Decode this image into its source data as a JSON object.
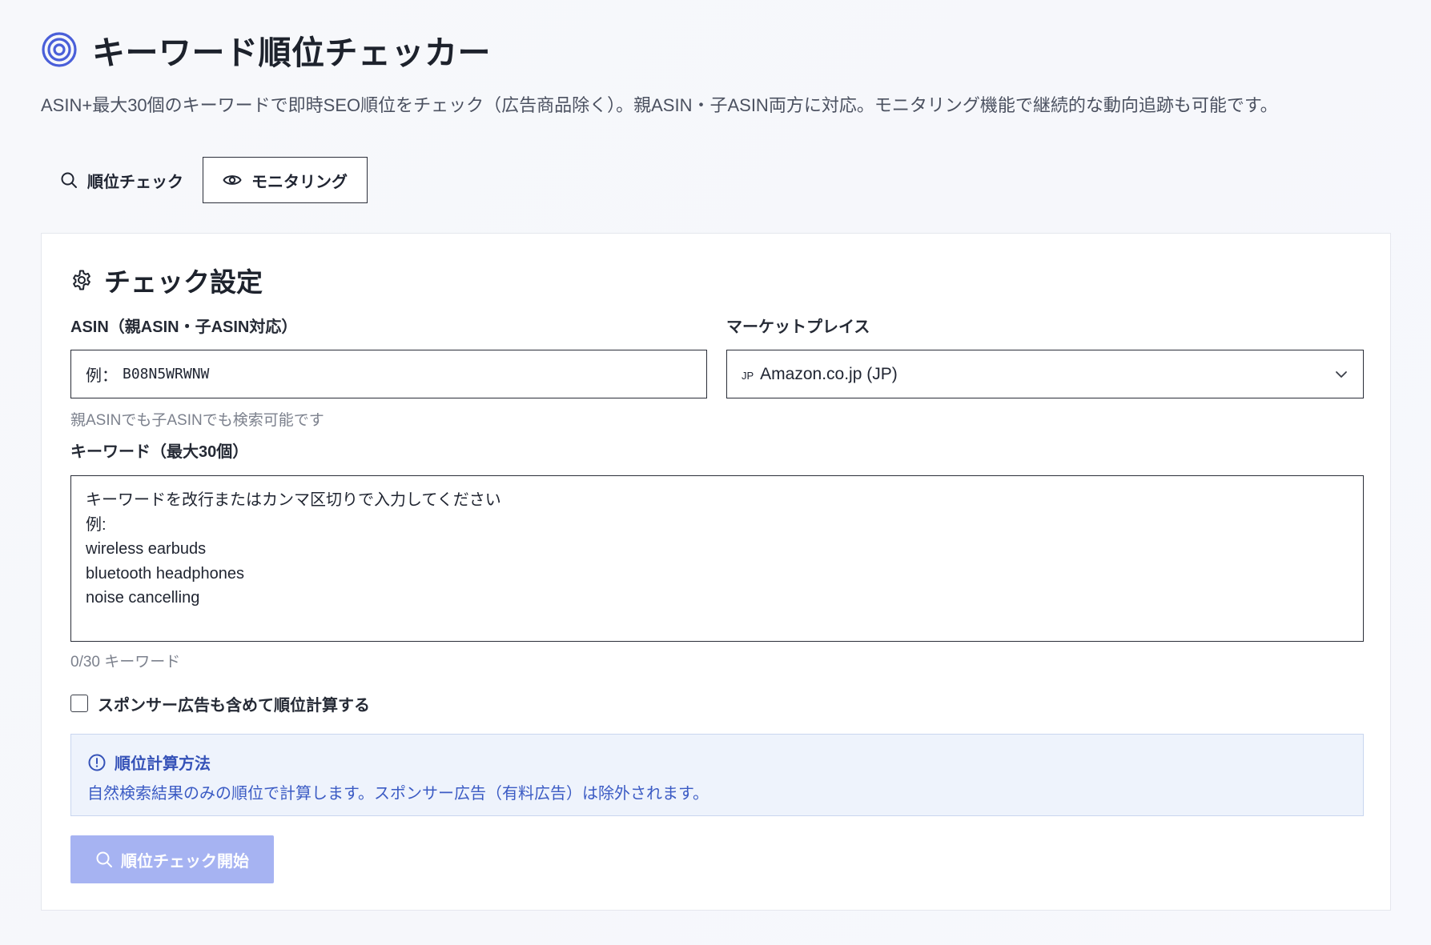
{
  "header": {
    "title": "キーワード順位チェッカー",
    "subtitle": "ASIN+最大30個のキーワードで即時SEO順位をチェック（広告商品除く）。親ASIN・子ASIN両方に対応。モニタリング機能で継続的な動向追跡も可能です。",
    "icon": "target-icon",
    "accent_color": "#4a5fd9"
  },
  "tabs": [
    {
      "label": "順位チェック",
      "icon": "search-icon",
      "active": false
    },
    {
      "label": "モニタリング",
      "icon": "eye-icon",
      "active": true
    }
  ],
  "settings": {
    "title": "チェック設定",
    "icon": "gear-icon",
    "asin": {
      "label": "ASIN（親ASIN・子ASIN対応）",
      "placeholder_prefix": "例：",
      "placeholder_value": "B08N5WRWNW",
      "helper": "親ASINでも子ASINでも検索可能です"
    },
    "marketplace": {
      "label": "マーケットプレイス",
      "selected_code": "JP",
      "selected_label": "Amazon.co.jp (JP)"
    },
    "keywords": {
      "label": "キーワード（最大30個）",
      "placeholder_lines": [
        "キーワードを改行またはカンマ区切りで入力してください",
        "例:",
        "wireless earbuds",
        "bluetooth headphones",
        "noise cancelling"
      ],
      "count_text": "0/30 キーワード"
    },
    "include_sponsored": {
      "label": "スポンサー広告も含めて順位計算する",
      "checked": false
    },
    "info": {
      "title": "順位計算方法",
      "text": "自然検索結果のみの順位で計算します。スポンサー広告（有料広告）は除外されます。",
      "color": "#3552b8",
      "background": "#eef3fc"
    },
    "start_button": {
      "label": "順位チェック開始",
      "icon": "search-icon",
      "color": "#a6b3f2"
    }
  }
}
